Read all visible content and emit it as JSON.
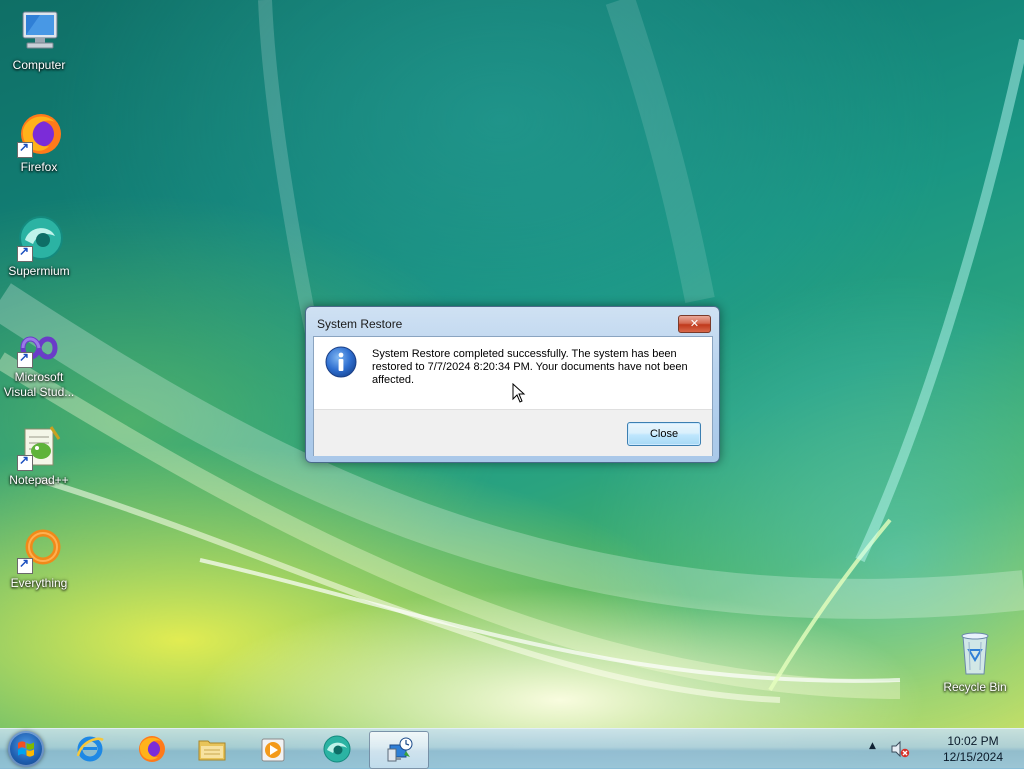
{
  "desktop": {
    "icons": [
      {
        "label": "Computer",
        "icon": "computer-icon"
      },
      {
        "label": "Firefox",
        "icon": "firefox-icon"
      },
      {
        "label": "Supermium",
        "icon": "supermium-icon"
      },
      {
        "label": "Microsoft Visual Stud...",
        "icon": "visual-studio-icon"
      },
      {
        "label": "Notepad++",
        "icon": "notepad-plus-plus-icon"
      },
      {
        "label": "Everything",
        "icon": "everything-search-icon"
      },
      {
        "label": "Recycle Bin",
        "icon": "recycle-bin-icon"
      }
    ]
  },
  "dialog": {
    "title": "System Restore",
    "icon": "information-icon",
    "message": "System Restore completed successfully. The system has been restored to 7/7/2024 8:20:34 PM. Your documents have not been affected.",
    "close_button": "Close"
  },
  "taskbar": {
    "start_icon": "windows-start-orb-icon",
    "pinned": [
      {
        "name": "Internet Explorer",
        "icon": "internet-explorer-icon"
      },
      {
        "name": "Firefox",
        "icon": "firefox-icon"
      },
      {
        "name": "File Explorer",
        "icon": "folder-icon"
      },
      {
        "name": "Media Player",
        "icon": "media-player-icon"
      },
      {
        "name": "Supermium",
        "icon": "supermium-icon"
      },
      {
        "name": "System Restore",
        "icon": "system-restore-icon",
        "active": true
      }
    ],
    "tray": {
      "show_hidden_icon": "up-arrow-icon",
      "volume_icon": "volume-muted-icon",
      "time": "10:02 PM",
      "date": "12/15/2024"
    }
  },
  "colors": {
    "dialog_frame": "#b9d3ee",
    "button_border": "#3c7fb1",
    "close_button_red": "#c0391c",
    "info_blue": "#1f5fb0"
  }
}
